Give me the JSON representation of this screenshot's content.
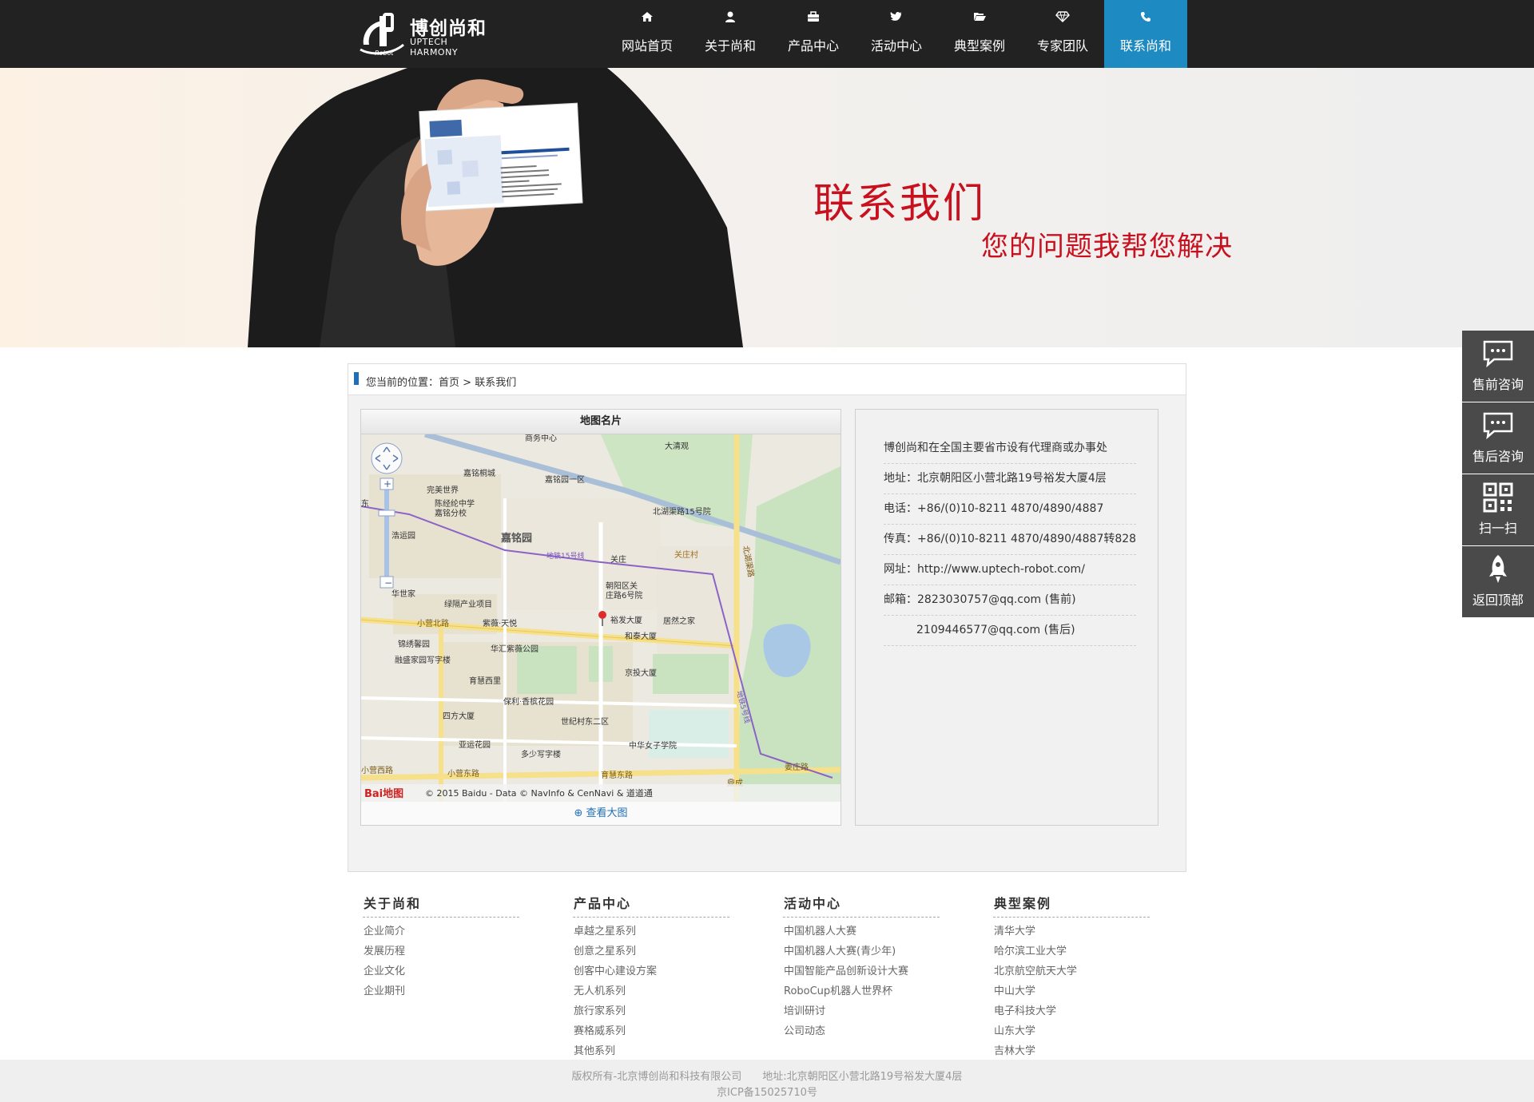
{
  "header": {
    "logo_cn": "博创尚和",
    "logo_en": "UPTECH HARMONY",
    "logo_robot": "Robot",
    "nav": [
      {
        "label": "网站首页",
        "icon": "home-icon"
      },
      {
        "label": "关于尚和",
        "icon": "user-icon"
      },
      {
        "label": "产品中心",
        "icon": "briefcase-icon"
      },
      {
        "label": "活动中心",
        "icon": "twitter-icon"
      },
      {
        "label": "典型案例",
        "icon": "folder-open-icon"
      },
      {
        "label": "专家团队",
        "icon": "diamond-icon"
      },
      {
        "label": "联系尚和",
        "icon": "phone-icon",
        "active": true
      }
    ]
  },
  "banner": {
    "title": "联系我们",
    "subtitle": "您的问题我帮您解决",
    "card_company": "北京博创尚和科技有限公司",
    "card_company_en": "Beijing Uptech Harmony Co., LTD",
    "card_logo": "博创尚和"
  },
  "breadcrumb": {
    "prefix": "您当前的位置：",
    "home": "首页",
    "sep": ">",
    "current": "联系我们"
  },
  "map_card": {
    "title": "地图名片",
    "link": "查看大图",
    "copyright": "© 2015 Baidu - Data © NavInfo & CenNavi & 道道通",
    "baidu": "Bai地图",
    "labels": {
      "l01": "商务中心",
      "l02": "大清观",
      "l03": "嘉铭桐城",
      "l04": "嘉铭园一区",
      "l05": "完美世界",
      "l06": "陈经纶中学",
      "l07": "嘉铭分校",
      "l08": "北湖渠路15号院",
      "l09": "嘉铭园",
      "l10": "地铁15号线",
      "l11": "关庄",
      "l12": "关庄村",
      "l13": "北湖渠路",
      "l14": "浩运园",
      "l15": "朝阳区关",
      "l16": "庄路6号院",
      "l17": "华世家",
      "l18": "绿隔产业项目",
      "l19": "小营北路",
      "l20": "紫薇·天悦",
      "l21": "裕发大厦",
      "l22": "居然之家",
      "l23": "和泰大厦",
      "l24": "锦绣馨园",
      "l25": "华汇紫薇公园",
      "l26": "融盛家园写字楼",
      "l27": "京投大厦",
      "l28": "育慧西里",
      "l29": "保利·香槟花园",
      "l30": "四方大厦",
      "l31": "世纪村东二区",
      "l32": "亚运花园",
      "l33": "中华女子学院",
      "l34": "多少写字楼",
      "l35": "小营西路",
      "l36": "小营东路",
      "l37": "育慧东路",
      "l38": "姜庄路",
      "l39": "地铁5号线",
      "l40": "东",
      "l41": "鼎成"
    }
  },
  "contact": {
    "intro": "博创尚和在全国主要省市设有代理商或办事处",
    "address": "地址：北京朝阳区小营北路19号裕发大厦4层",
    "phone": "电话：+86/(0)10-8211 4870/4890/4887",
    "fax": "传真：+86/(0)10-8211 4870/4890/4887转828",
    "web": "网址：http://www.uptech-robot.com/",
    "email1": "邮箱：2823030757@qq.com (售前)",
    "email2": "2109446577@qq.com (售后)"
  },
  "side": [
    {
      "label": "售前咨询",
      "icon": "chat-icon"
    },
    {
      "label": "售后咨询",
      "icon": "chat-icon"
    },
    {
      "label": "扫一扫",
      "icon": "qrcode-icon"
    },
    {
      "label": "返回顶部",
      "icon": "rocket-icon"
    }
  ],
  "footer": {
    "cols": [
      {
        "title": "关于尚和",
        "items": [
          "企业简介",
          "发展历程",
          "企业文化",
          "企业期刊"
        ]
      },
      {
        "title": "产品中心",
        "items": [
          "卓越之星系列",
          "创意之星系列",
          "创客中心建设方案",
          "无人机系列",
          "旅行家系列",
          "赛格威系列",
          "其他系列"
        ]
      },
      {
        "title": "活动中心",
        "items": [
          "中国机器人大赛",
          "中国机器人大赛(青少年)",
          "中国智能产品创新设计大赛",
          "RoboCup机器人世界杯",
          "培训研讨",
          "公司动态"
        ]
      },
      {
        "title": "典型案例",
        "items": [
          "清华大学",
          "哈尔滨工业大学",
          "北京航空航天大学",
          "中山大学",
          "电子科技大学",
          "山东大学",
          "吉林大学"
        ]
      }
    ],
    "copyright": "版权所有-北京博创尚和科技有限公司　　地址:北京朝阳区小营北路19号裕发大厦4层",
    "icp": "京ICP备15025710号"
  }
}
